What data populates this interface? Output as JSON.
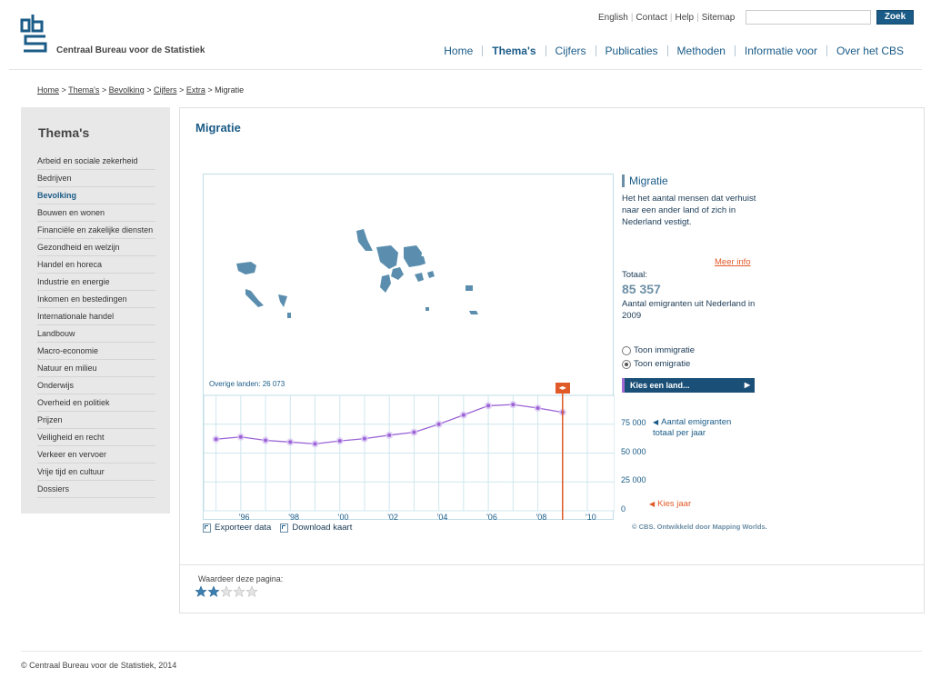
{
  "header": {
    "org_name": "Centraal Bureau voor de Statistiek",
    "top_links": [
      "English",
      "Contact",
      "Help",
      "Sitemap"
    ],
    "search_button": "Zoek",
    "nav": [
      {
        "label": "Home",
        "active": false
      },
      {
        "label": "Thema's",
        "active": true
      },
      {
        "label": "Cijfers",
        "active": false
      },
      {
        "label": "Publicaties",
        "active": false
      },
      {
        "label": "Methoden",
        "active": false
      },
      {
        "label": "Informatie voor",
        "active": false
      },
      {
        "label": "Over het CBS",
        "active": false
      }
    ]
  },
  "breadcrumb": {
    "items": [
      "Home",
      "Thema's",
      "Bevolking",
      "Cijfers",
      "Extra"
    ],
    "separator": ">",
    "current": "Migratie"
  },
  "sidebar": {
    "title": "Thema's",
    "items": [
      "Arbeid en sociale zekerheid",
      "Bedrijven",
      "Bevolking",
      "Bouwen en wonen",
      "Financiële en zakelijke diensten",
      "Gezondheid en welzijn",
      "Handel en horeca",
      "Industrie en energie",
      "Inkomen en bestedingen",
      "Internationale handel",
      "Landbouw",
      "Macro-economie",
      "Natuur en milieu",
      "Onderwijs",
      "Overheid en politiek",
      "Prijzen",
      "Veiligheid en recht",
      "Verkeer en vervoer",
      "Vrije tijd en cultuur",
      "Dossiers"
    ],
    "active_index": 2
  },
  "content": {
    "title": "Migratie"
  },
  "viz": {
    "other_countries": "Overige landen: 26 073",
    "marker_glyph": "◂▸",
    "info_title": "Migratie",
    "info_desc": "Het het aantal mensen dat verhuist naar een ander land of zich in Nederland vestigt.",
    "meer_info": "Meer info",
    "total_label": "Totaal:",
    "total_value": "85 357",
    "total_desc": "Aantal emigranten uit Nederland in 2009",
    "radio_immigratie": "Toon immigratie",
    "radio_emigratie": "Toon emigratie",
    "radio_selected": "emigratie",
    "country_select": "Kies een land...",
    "series_desc": "Aantal emigranten totaal per jaar",
    "kies_jaar": "Kies jaar",
    "export_label": "Exporteer data",
    "download_label": "Download kaart",
    "credit": "© CBS. Ontwikkeld door Mapping Worlds.",
    "line_color": "#9b63d6",
    "accent_color": "#e05a28",
    "map_color": "#5b8eae"
  },
  "chart_data": {
    "type": "line",
    "x": [
      1995,
      1996,
      1997,
      1998,
      1999,
      2000,
      2001,
      2002,
      2003,
      2004,
      2005,
      2006,
      2007,
      2008,
      2009
    ],
    "series": [
      {
        "values": [
          62000,
          64000,
          61000,
          59500,
          58000,
          60500,
          62500,
          65500,
          68000,
          75000,
          83000,
          91000,
          92000,
          89000,
          85357
        ]
      }
    ],
    "xtick_labels": [
      "'96",
      "'98",
      "'00",
      "'02",
      "'04",
      "'06",
      "'08",
      "'10"
    ],
    "xtick_years": [
      1996,
      1998,
      2000,
      2002,
      2004,
      2006,
      2008,
      2010
    ],
    "ytick_labels": [
      "75 000",
      "50 000",
      "25 000",
      "0"
    ],
    "ytick_values": [
      75000,
      50000,
      25000,
      0
    ],
    "xlim": [
      1994.5,
      2010
    ],
    "ylim": [
      0,
      100000
    ],
    "selected_year": 2009,
    "grid": true
  },
  "rating": {
    "label": "Waardeer deze pagina:",
    "value": 2,
    "max": 5
  },
  "footer": {
    "copyright": "© Centraal Bureau voor de Statistiek, 2014"
  }
}
